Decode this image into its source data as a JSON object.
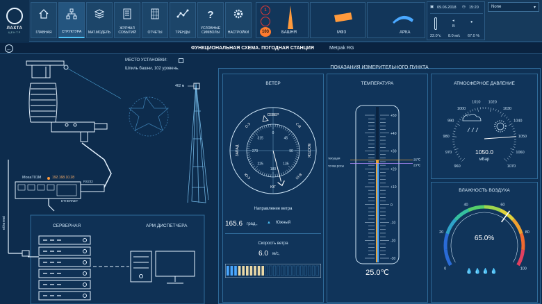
{
  "logo": {
    "name": "ЛАХТА",
    "sub": "ЦЕНТР"
  },
  "nav": [
    {
      "label": "ГЛАВНАЯ",
      "icon": "home-icon"
    },
    {
      "label": "СТРУКТУРА",
      "icon": "structure-icon"
    },
    {
      "label": "МАТ.МОДЕЛЬ",
      "icon": "layers-icon"
    },
    {
      "label": "ЖУРНАЛ СОБЫТИЙ",
      "icon": "journal-icon"
    },
    {
      "label": "ОТЧЕТЫ",
      "icon": "report-icon"
    },
    {
      "label": "ТРЕНДЫ",
      "icon": "trend-icon"
    },
    {
      "label": "УСЛОВНЫЕ СИМВОЛЫ",
      "icon": "question-icon"
    },
    {
      "label": "НАСТРОЙКИ",
      "icon": "gear-icon"
    }
  ],
  "status": {
    "alarm_count_top": "1",
    "alarm_count_bottom": "103",
    "tower_label": "БАШНЯ",
    "mfz_label": "МФЗ",
    "arka_label": "АРКА"
  },
  "info": {
    "date": "09.06.2018",
    "time": "15:20",
    "wind_dir": "В",
    "temp": "22.0°с",
    "wind_speed": "8.0 м/с",
    "humidity": "67.0 %"
  },
  "selector": {
    "value": "None"
  },
  "title": {
    "main": "ФУНКЦИОНАЛЬНАЯ СХЕМА. ПОГОДНАЯ СТАНЦИЯ",
    "device": "Metpak RG"
  },
  "install": {
    "label": "МЕСТО УСТАНОВКИ:",
    "place": "Шпиль башни, 102 уровень.",
    "height": "462 м"
  },
  "hardware": {
    "moxa": "MoxaT01M",
    "ip": "192.168.10.28",
    "rs232": "RS232",
    "ethernet_port": "ETHERNET",
    "ethernet_line": "ethernet",
    "server": "СЕРВЕРНАЯ",
    "arm": "АРМ ДИСПЕТЧЕРА"
  },
  "readings": {
    "title": "ПОКАЗАНИЯ ИЗМЕРИТЕЛЬНОГО ПУНКТА",
    "wind": {
      "title": "ВЕТЕР",
      "dirs": [
        "СЕВЕР",
        "С-В",
        "ВОСТОК",
        "Ю-В",
        "ЮГ",
        "Ю-З",
        "ЗАПАД",
        "С-З"
      ],
      "degrees": [
        "0",
        "45",
        "90",
        "135",
        "180",
        "225",
        "270",
        "315"
      ],
      "dir_label": "Направление ветра",
      "dir_value": "165.6",
      "dir_unit": "град.,",
      "dir_text": "Южный",
      "dir_deg": 165.6,
      "speed_label": "Скорость ветра",
      "speed_value": "6.0",
      "speed_unit": "м/с,",
      "speed_fraction": 0.4
    },
    "temperature": {
      "title": "ТЕМПЕРАТУРА",
      "ticks": [
        "+50",
        "+40",
        "+30",
        "+20",
        "+10",
        "0",
        "-10",
        "-20",
        "-30"
      ],
      "current_label": "текущая",
      "dew_label": "точка росы",
      "current_value": "25℃",
      "dew_value": "23℃",
      "value": "25.0℃",
      "current": 25,
      "dew": 23
    },
    "pressure": {
      "title": "АТМОСФЕРНОЕ ДАВЛЕНИЕ",
      "ticks": [
        "960",
        "970",
        "980",
        "990",
        "1000",
        "1010",
        "1020",
        "1030",
        "1040",
        "1050",
        "1060",
        "1070"
      ],
      "value": "1050.0",
      "unit": "мБар",
      "current": 1050
    },
    "humidity": {
      "title": "ВЛАЖНОСТЬ ВОЗДУХА",
      "value": "65.0%",
      "ticks": [
        "0",
        "20",
        "40",
        "60",
        "80",
        "100"
      ],
      "current": 65
    }
  }
}
